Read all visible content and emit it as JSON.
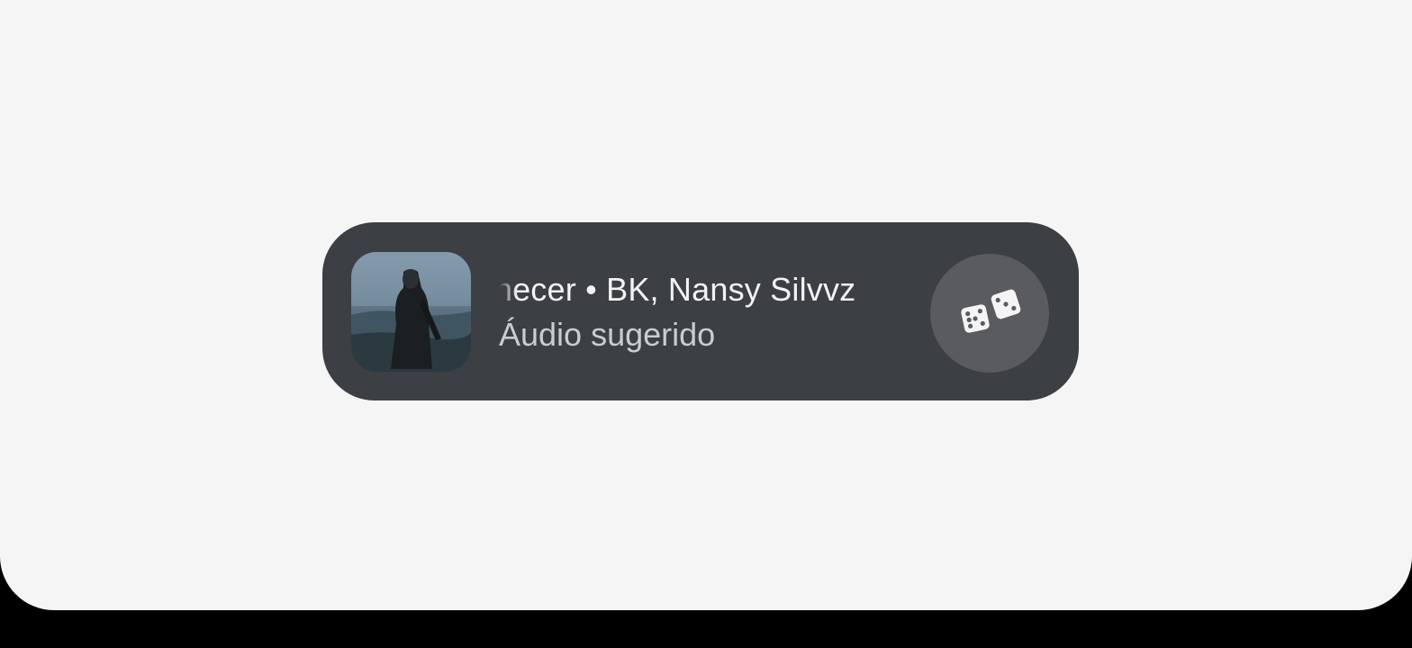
{
  "audio_suggestion": {
    "title_marquee": "Amanhecer • BK, Nansy Silvvz",
    "subtitle": "Áudio sugerido",
    "cover_icon": "album-cover-image",
    "shuffle_icon": "dice-icon"
  },
  "colors": {
    "screen_background": "#f5f5f5",
    "pill_background": "#3c3f44",
    "dice_button_background": "#595b5f",
    "title_text": "#f2f2f2",
    "subtitle_text": "#c9ccd0"
  }
}
